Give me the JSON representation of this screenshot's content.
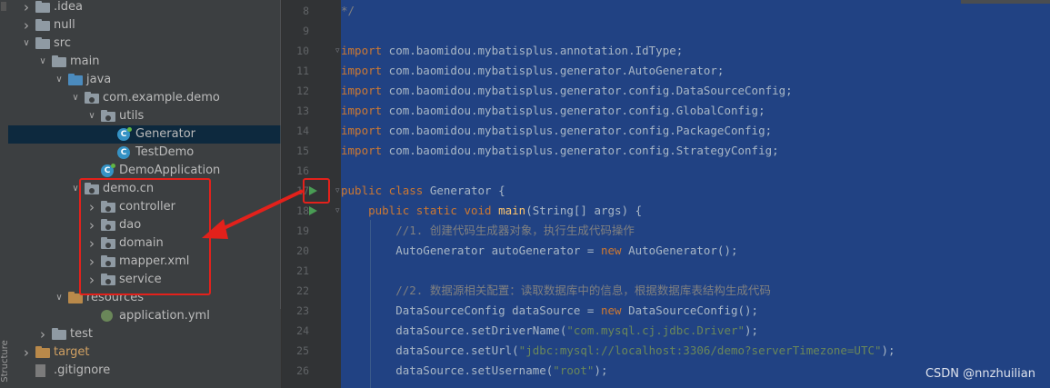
{
  "sidebar": {
    "vertical_tab": "Structure",
    "tree": [
      {
        "label": ".idea",
        "icon": "folder-icon",
        "indent": 1,
        "arrow": "collapsed"
      },
      {
        "label": "null",
        "icon": "folder-icon",
        "indent": 1,
        "arrow": "collapsed"
      },
      {
        "label": "src",
        "icon": "folder-icon",
        "indent": 1,
        "arrow": "expanded"
      },
      {
        "label": "main",
        "icon": "folder-icon",
        "indent": 2,
        "arrow": "expanded"
      },
      {
        "label": "java",
        "icon": "source-folder-icon",
        "indent": 3,
        "arrow": "expanded"
      },
      {
        "label": "com.example.demo",
        "icon": "package-icon",
        "indent": 4,
        "arrow": "expanded"
      },
      {
        "label": "utils",
        "icon": "package-icon",
        "indent": 5,
        "arrow": "expanded"
      },
      {
        "label": "Generator",
        "icon": "class-runnable-icon",
        "indent": 6,
        "arrow": "none",
        "selected": true
      },
      {
        "label": "TestDemo",
        "icon": "class-icon",
        "indent": 6,
        "arrow": "none"
      },
      {
        "label": "DemoApplication",
        "icon": "class-runnable-icon",
        "indent": 5,
        "arrow": "none"
      },
      {
        "label": "demo.cn",
        "icon": "package-icon",
        "indent": 4,
        "arrow": "expanded"
      },
      {
        "label": "controller",
        "icon": "package-icon",
        "indent": 5,
        "arrow": "collapsed"
      },
      {
        "label": "dao",
        "icon": "package-icon",
        "indent": 5,
        "arrow": "collapsed"
      },
      {
        "label": "domain",
        "icon": "package-icon",
        "indent": 5,
        "arrow": "collapsed"
      },
      {
        "label": "mapper.xml",
        "icon": "package-icon",
        "indent": 5,
        "arrow": "collapsed"
      },
      {
        "label": "service",
        "icon": "package-icon",
        "indent": 5,
        "arrow": "collapsed"
      },
      {
        "label": "resources",
        "icon": "resources-folder-icon",
        "indent": 3,
        "arrow": "expanded"
      },
      {
        "label": "application.yml",
        "icon": "yaml-file-icon",
        "indent": 5,
        "arrow": "none"
      },
      {
        "label": "test",
        "icon": "folder-icon",
        "indent": 2,
        "arrow": "collapsed"
      },
      {
        "label": "target",
        "icon": "excluded-folder-icon",
        "indent": 1,
        "arrow": "collapsed"
      },
      {
        "label": ".gitignore",
        "icon": "file-icon",
        "indent": 1,
        "arrow": "none"
      }
    ]
  },
  "editor": {
    "line_numbers": [
      "8",
      "9",
      "10",
      "11",
      "12",
      "13",
      "14",
      "15",
      "16",
      "17",
      "18",
      "19",
      "20",
      "21",
      "22",
      "23",
      "24",
      "25",
      "26"
    ],
    "run_icon_lines": [
      "17",
      "18"
    ],
    "lines": [
      [
        {
          "t": "*/",
          "c": "cm"
        }
      ],
      [],
      [
        {
          "t": "import",
          "c": "kw"
        },
        {
          "t": " com.baomidou.mybatisplus.annotation.IdType;",
          "c": ""
        }
      ],
      [
        {
          "t": "import",
          "c": "kw"
        },
        {
          "t": " com.baomidou.mybatisplus.generator.AutoGenerator;",
          "c": ""
        }
      ],
      [
        {
          "t": "import",
          "c": "kw"
        },
        {
          "t": " com.baomidou.mybatisplus.generator.config.DataSourceConfig;",
          "c": ""
        }
      ],
      [
        {
          "t": "import",
          "c": "kw"
        },
        {
          "t": " com.baomidou.mybatisplus.generator.config.GlobalConfig;",
          "c": ""
        }
      ],
      [
        {
          "t": "import",
          "c": "kw"
        },
        {
          "t": " com.baomidou.mybatisplus.generator.config.PackageConfig;",
          "c": ""
        }
      ],
      [
        {
          "t": "import",
          "c": "kw"
        },
        {
          "t": " com.baomidou.mybatisplus.generator.config.StrategyConfig;",
          "c": ""
        }
      ],
      [],
      [
        {
          "t": "public class",
          "c": "kw"
        },
        {
          "t": " Generator {",
          "c": ""
        }
      ],
      [
        {
          "t": "    ",
          "c": ""
        },
        {
          "t": "public static void",
          "c": "kw"
        },
        {
          "t": " ",
          "c": ""
        },
        {
          "t": "main",
          "c": "fn"
        },
        {
          "t": "(String[] args) {",
          "c": ""
        }
      ],
      [
        {
          "t": "        //1. 创建代码生成器对象，执行生成代码操作",
          "c": "cm"
        }
      ],
      [
        {
          "t": "        AutoGenerator autoGenerator = ",
          "c": ""
        },
        {
          "t": "new",
          "c": "kw"
        },
        {
          "t": " AutoGenerator();",
          "c": ""
        }
      ],
      [],
      [
        {
          "t": "        //2. 数据源相关配置：读取数据库中的信息，根据数据库表结构生成代码",
          "c": "cm"
        }
      ],
      [
        {
          "t": "        DataSourceConfig dataSource = ",
          "c": ""
        },
        {
          "t": "new",
          "c": "kw"
        },
        {
          "t": " DataSourceConfig();",
          "c": ""
        }
      ],
      [
        {
          "t": "        dataSource.setDriverName(",
          "c": ""
        },
        {
          "t": "\"com.mysql.cj.jdbc.Driver\"",
          "c": "str"
        },
        {
          "t": ");",
          "c": ""
        }
      ],
      [
        {
          "t": "        dataSource.setUrl(",
          "c": ""
        },
        {
          "t": "\"jdbc:mysql://localhost:3306/demo?serverTimezone=UTC\"",
          "c": "str"
        },
        {
          "t": ");",
          "c": ""
        }
      ],
      [
        {
          "t": "        dataSource.setUsername(",
          "c": ""
        },
        {
          "t": "\"root\"",
          "c": "str"
        },
        {
          "t": ");",
          "c": ""
        }
      ]
    ]
  },
  "watermark": "CSDN @nnzhuilian",
  "colors": {
    "annotation_red": "#e3211b",
    "selection_blue": "#214283"
  }
}
